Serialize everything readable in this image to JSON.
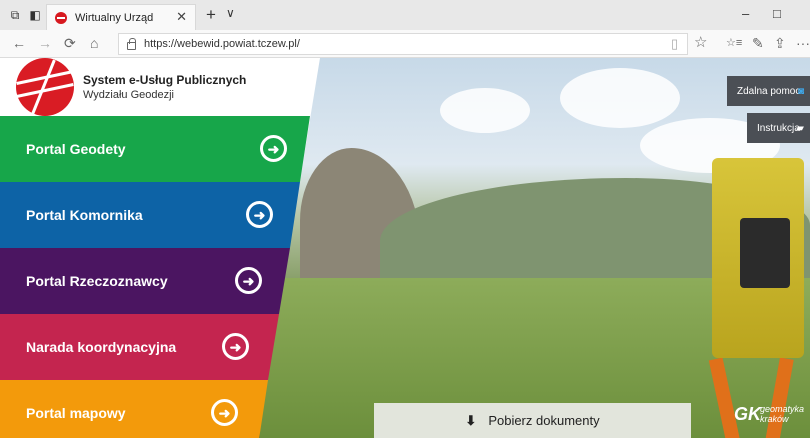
{
  "browser": {
    "tab_title": "Wirtualny Urząd",
    "url": "https://webewid.powiat.tczew.pl/",
    "icons": {
      "tab_actions": "⧉",
      "tab_preview": "◧",
      "tab_close": "✕",
      "new_tab": "+",
      "tab_list": "∨",
      "minimize": "–",
      "maximize": "□",
      "back": "←",
      "forward": "→",
      "refresh": "⟳",
      "home": "⌂",
      "reading": "▯",
      "favorite": "☆",
      "favorites_bar": "☆≡",
      "pen": "✎",
      "share": "⇪",
      "more": "···"
    }
  },
  "header": {
    "title": "System e-Usług Publicznych",
    "subtitle": "Wydziału Geodezji"
  },
  "portals": [
    {
      "label": "Portal Geodety",
      "color": "#17a64a"
    },
    {
      "label": "Portal Komornika",
      "color": "#0d63a6"
    },
    {
      "label": "Portal Rzeczoznawcy",
      "color": "#4b1561"
    },
    {
      "label": "Narada koordynacyjna",
      "color": "#c4254f"
    },
    {
      "label": "Portal mapowy",
      "color": "#f39a0b"
    }
  ],
  "portal_arrow_icon": "➜",
  "help": {
    "remote_help": "Zdalna pomoc",
    "instructions": "Instrukcja",
    "remote_icon": "◙",
    "instructions_icon": "▰"
  },
  "download": {
    "label": "Pobierz dokumenty",
    "icon": "⬇"
  },
  "brand": {
    "gk": "GK",
    "line1": "geomatyka",
    "line2": "kraków"
  }
}
